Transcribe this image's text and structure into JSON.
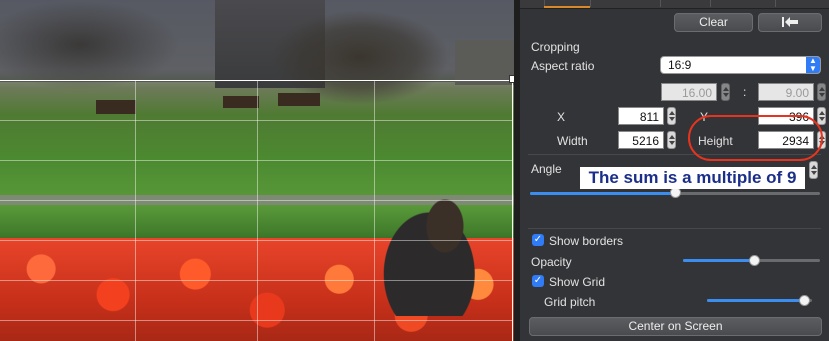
{
  "panel": {
    "clear_label": "Clear",
    "undo_icon": "undo-arrow-icon",
    "section_title": "Cropping",
    "aspect_label": "Aspect ratio",
    "aspect_value": "16:9",
    "ratio_w": "16.00",
    "ratio_sep": ":",
    "ratio_h": "9.00",
    "x_label": "X",
    "x_value": "811",
    "y_label": "Y",
    "y_value": "396",
    "width_label": "Width",
    "width_value": "5216",
    "height_label": "Height",
    "height_value": "2934",
    "angle_label": "Angle",
    "angle_level": 0.5,
    "show_borders_label": "Show borders",
    "show_borders_checked": true,
    "opacity_label": "Opacity",
    "opacity_level": 0.52,
    "show_grid_label": "Show Grid",
    "show_grid_checked": true,
    "grid_pitch_label": "Grid pitch",
    "grid_pitch_level": 0.92,
    "center_label": "Center on Screen"
  },
  "annotation": {
    "text": "The sum is a multiple of 9",
    "color": "#e8341f"
  },
  "colors": {
    "accent_blue": "#2f7cf6",
    "tab_active": "#d88a2b"
  }
}
